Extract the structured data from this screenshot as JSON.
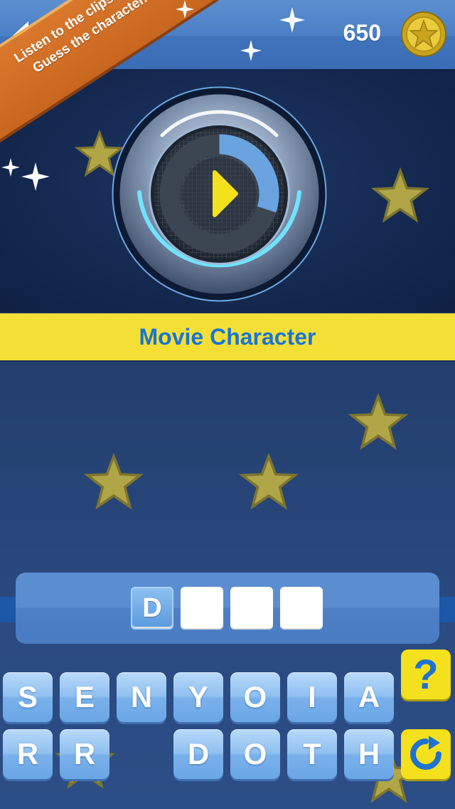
{
  "header": {
    "back_icon": "back-arrow-icon",
    "coins": "650",
    "coin_icon": "gold-star-coin-icon"
  },
  "ribbon": {
    "line1": "Listen to the clips",
    "line2": "Guess the character/show!",
    "icon": "music-note-icon",
    "color": "#cf6d23"
  },
  "player": {
    "play_icon": "play-icon",
    "progress": 0.3,
    "accent": "#6aa3e0"
  },
  "category": {
    "label": "Movie Character",
    "banner_color": "#f4df36",
    "text_color": "#1a75d2"
  },
  "answer": {
    "letters": [
      "D",
      "",
      "",
      ""
    ]
  },
  "keyboard": {
    "row1": [
      "S",
      "E",
      "N",
      "Y",
      "O",
      "I",
      "A"
    ],
    "row2": [
      "R",
      "R",
      "",
      "D",
      "O",
      "T",
      "H"
    ]
  },
  "tools": {
    "hint_label": "?",
    "hint_icon": "question-mark-icon",
    "refresh_icon": "refresh-icon",
    "color": "#f4e01c"
  }
}
